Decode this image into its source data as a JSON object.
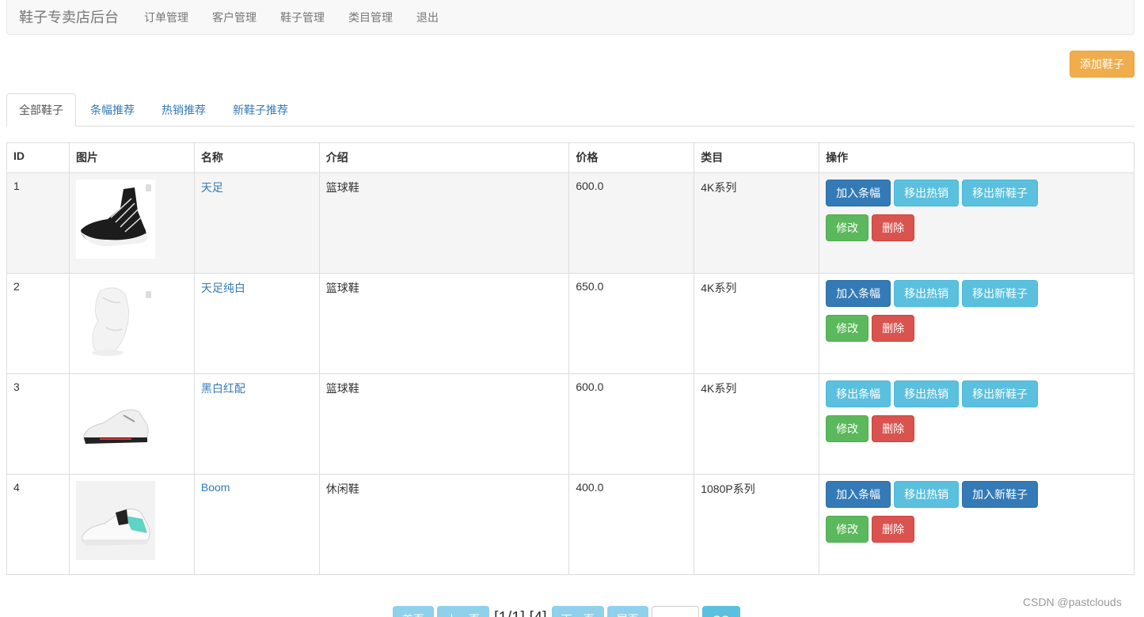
{
  "navbar": {
    "brand": "鞋子专卖店后台",
    "links": [
      "订单管理",
      "客户管理",
      "鞋子管理",
      "类目管理",
      "退出"
    ]
  },
  "add_button": "添加鞋子",
  "tabs": [
    "全部鞋子",
    "条幅推荐",
    "热销推荐",
    "新鞋子推荐"
  ],
  "table": {
    "headers": [
      "ID",
      "图片",
      "名称",
      "介绍",
      "价格",
      "类目",
      "操作"
    ],
    "rows": [
      {
        "id": "1",
        "name": "天足",
        "intro": "篮球鞋",
        "price": "600.0",
        "category": "4K系列",
        "image": "black-high-top-shoe",
        "banner_btn": "加入条幅",
        "hot_btn": "移出热销",
        "new_btn": "移出新鞋子",
        "edit_btn": "修改",
        "delete_btn": "删除"
      },
      {
        "id": "2",
        "name": "天足纯白",
        "intro": "篮球鞋",
        "price": "650.0",
        "category": "4K系列",
        "image": "white-high-top-shoe",
        "banner_btn": "加入条幅",
        "hot_btn": "移出热销",
        "new_btn": "移出新鞋子",
        "edit_btn": "修改",
        "delete_btn": "删除"
      },
      {
        "id": "3",
        "name": "黑白红配",
        "intro": "篮球鞋",
        "price": "600.0",
        "category": "4K系列",
        "image": "white-red-sneaker",
        "banner_btn": "移出条幅",
        "hot_btn": "移出热销",
        "new_btn": "移出新鞋子",
        "edit_btn": "修改",
        "delete_btn": "删除"
      },
      {
        "id": "4",
        "name": "Boom",
        "intro": "休闲鞋",
        "price": "400.0",
        "category": "1080P系列",
        "image": "white-teal-sneaker",
        "banner_btn": "加入条幅",
        "hot_btn": "移出热销",
        "new_btn": "加入新鞋子",
        "edit_btn": "修改",
        "delete_btn": "删除"
      }
    ]
  },
  "pagination": {
    "first": "首页",
    "prev": "上一页",
    "info": "[1/1] [4]",
    "next": "下一页",
    "last": "尾页",
    "go": "GO"
  },
  "watermark": "CSDN @pastclouds",
  "colors": {
    "primary": "#337ab7",
    "info": "#5bc0de",
    "success": "#5cb85c",
    "danger": "#d9534f",
    "warning": "#f0ad4e"
  }
}
